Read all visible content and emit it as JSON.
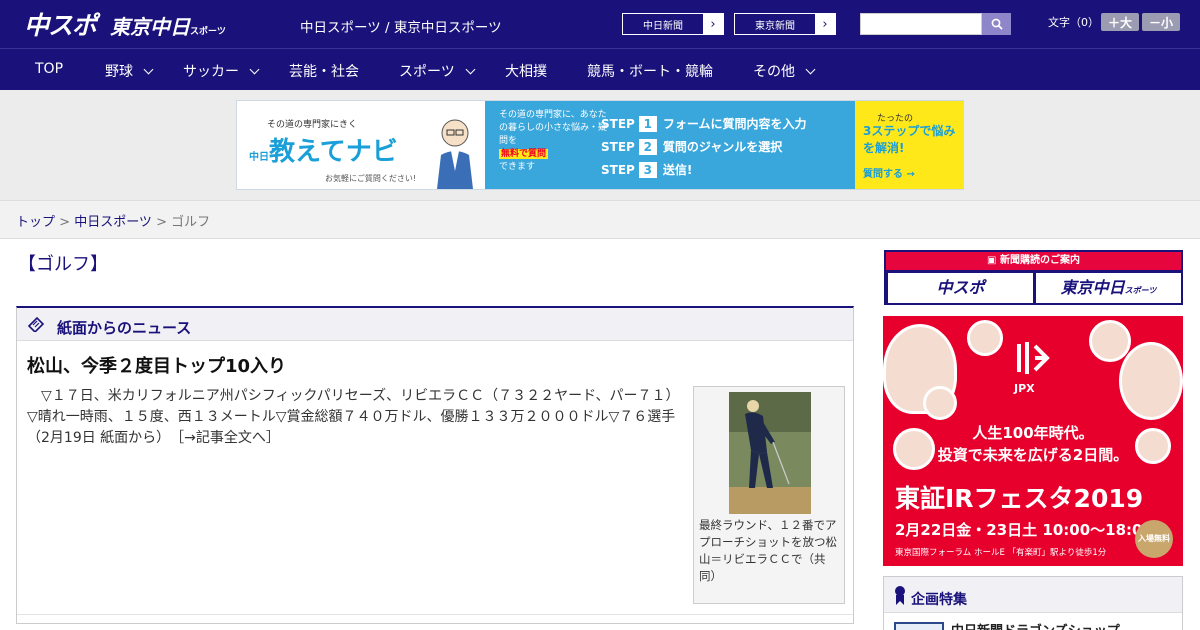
{
  "header": {
    "logo_chuspo": "中スポ",
    "logo_tokyo": "東京中日",
    "logo_tokyo_small": "スポーツ",
    "site_name": "中日スポーツ / 東京中日スポーツ",
    "paper_buttons": [
      "中日新聞",
      "東京新聞"
    ],
    "search_placeholder": "",
    "font_size_label": "文字（0）",
    "font_plus": "＋大",
    "font_minus": "－小"
  },
  "nav": {
    "items": [
      {
        "label": "TOP"
      },
      {
        "label": "野球"
      },
      {
        "label": "サッカー"
      },
      {
        "label": "芸能・社会"
      },
      {
        "label": "スポーツ"
      },
      {
        "label": "大相撲"
      },
      {
        "label": "競馬・ボート・競輪"
      },
      {
        "label": "その他"
      }
    ]
  },
  "ad_banner": {
    "tagline": "その道の専門家にきく",
    "title": "教えてナビ",
    "title_prefix": "中日",
    "note": "お気軽にご質問ください!",
    "desc_1": "その道の専門家に、あなたの暮らしの小さな悩み・疑問を",
    "desc_highlight": "無料で質問",
    "desc_2": "できます",
    "steps": [
      {
        "label": "STEP",
        "num": "1",
        "text": "フォームに質問内容を入力"
      },
      {
        "label": "STEP",
        "num": "2",
        "text": "質問のジャンルを選択"
      },
      {
        "label": "STEP",
        "num": "3",
        "text": "送信!"
      }
    ],
    "right_small": "たったの",
    "right_big": "3ステップで悩みを解消!",
    "right_cta": "質問する →"
  },
  "breadcrumb": {
    "home": "トップ",
    "sep": " > ",
    "section": "中日スポーツ",
    "current": "ゴルフ"
  },
  "main": {
    "page_title": "【ゴルフ】",
    "news_head": "紙面からのニュース",
    "article": {
      "title": "松山、今季２度目トップ10入り",
      "body": "▽１７日、米カリフォルニア州パシフィックパリセーズ、リビエラＣＣ（７３２２ヤード、パー７１）▽晴れ一時雨、１５度、西１３メートル▽賞金総額７４０万ドル、優勝１３３万２０００ドル▽７６選手（2月19日 紙面から）",
      "more": "［→記事全文へ］",
      "photo_caption": "最終ラウンド、１２番でアプローチショットを放つ松山＝リビエラＣＣで（共同）"
    }
  },
  "sidebar": {
    "subscribe_head": "新聞購読のご案内",
    "subscribe_buttons": [
      "中スポ",
      "東京中日"
    ],
    "subscribe_small": "スポーツ",
    "ad": {
      "brand": "JPX",
      "line1": "人生100年時代。",
      "line2": "投資で未来を広げる2日間。",
      "fest": "東証IRフェスタ2019",
      "date": "2月22日金・23日土 10:00～18:00",
      "venue": "東京国際フォーラム ホールE 「有楽町」駅より徒歩1分",
      "free": "入場無料"
    },
    "feature_title": "企画特集",
    "feature_item": "中日新聞ドラゴンズショップ"
  },
  "colors": {
    "brand": "#1a127a",
    "accent": "#e8002d"
  }
}
